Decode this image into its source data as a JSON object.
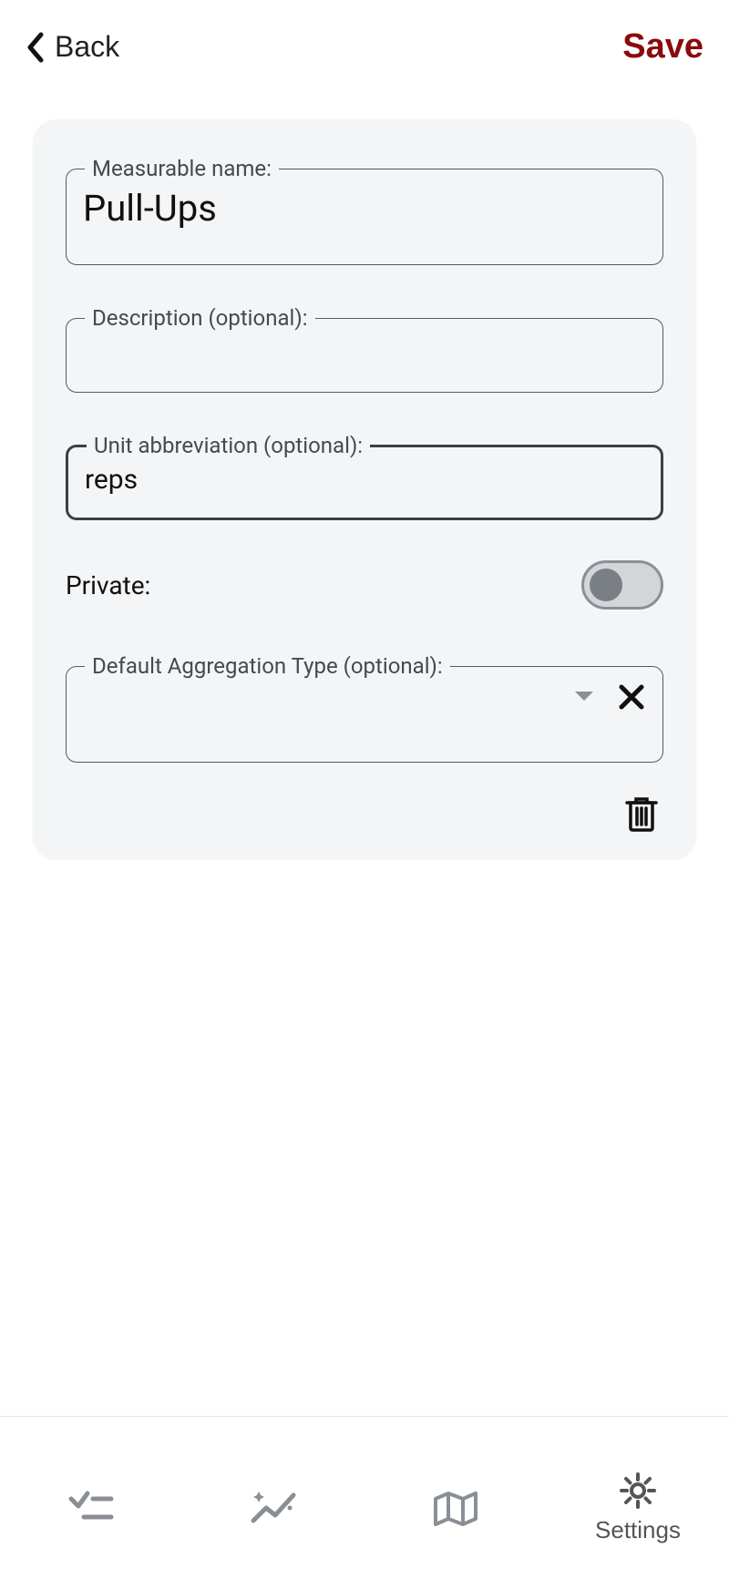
{
  "header": {
    "back_label": "Back",
    "save_label": "Save"
  },
  "form": {
    "name_label": "Measurable name:",
    "name_value": "Pull-Ups",
    "description_label": "Description (optional):",
    "description_value": "",
    "unit_label": "Unit abbreviation (optional):",
    "unit_value": "reps",
    "private_label": "Private:",
    "private_on": false,
    "aggregation_label": "Default Aggregation Type (optional):",
    "aggregation_value": ""
  },
  "nav": {
    "tab4_label": "Settings"
  }
}
